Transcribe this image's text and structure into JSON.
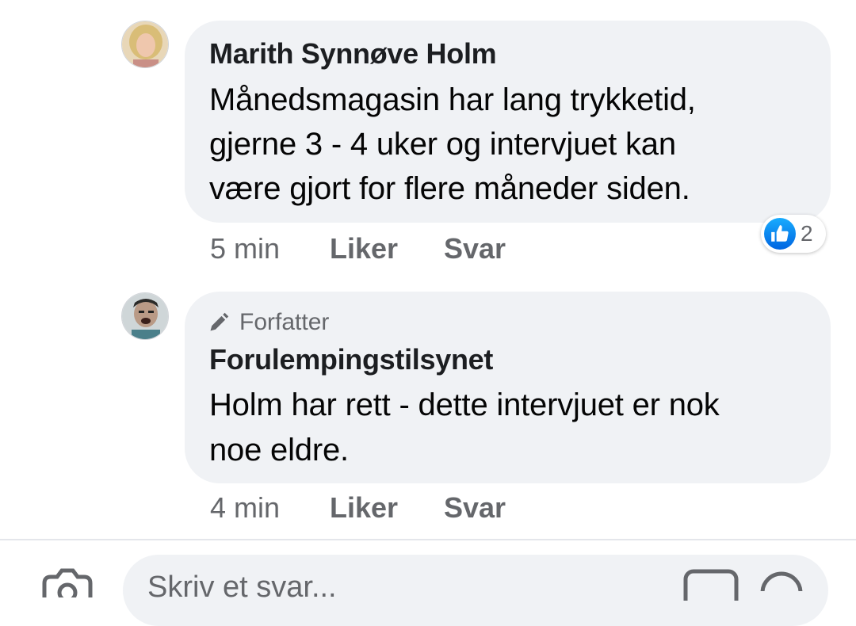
{
  "comments": [
    {
      "author": "Marith Synnøve Holm",
      "lines": [
        "Månedsmagasin  har  lang  trykketid,",
        "gjerne  3   - 4  uker og intervjuet  kan",
        "være  gjort  for  flere  måneder siden."
      ],
      "time": "5 min",
      "like_label": "Liker",
      "reply_label": "Svar",
      "reaction_count": "2"
    },
    {
      "badge": "Forfatter",
      "author": "Forulempingstilsynet",
      "lines": [
        "Holm har rett - dette intervjuet er nok",
        "noe eldre."
      ],
      "time": "4 min",
      "like_label": "Liker",
      "reply_label": "Svar"
    }
  ],
  "composer": {
    "placeholder": "Skriv et svar..."
  },
  "colors": {
    "bubble": "#f0f2f5",
    "meta_text": "#65676b",
    "like_blue": "#1877f2"
  },
  "icons": [
    "avatar",
    "like-reaction-icon",
    "pencil-icon",
    "camera-icon",
    "gif-icon",
    "emoji-icon"
  ]
}
